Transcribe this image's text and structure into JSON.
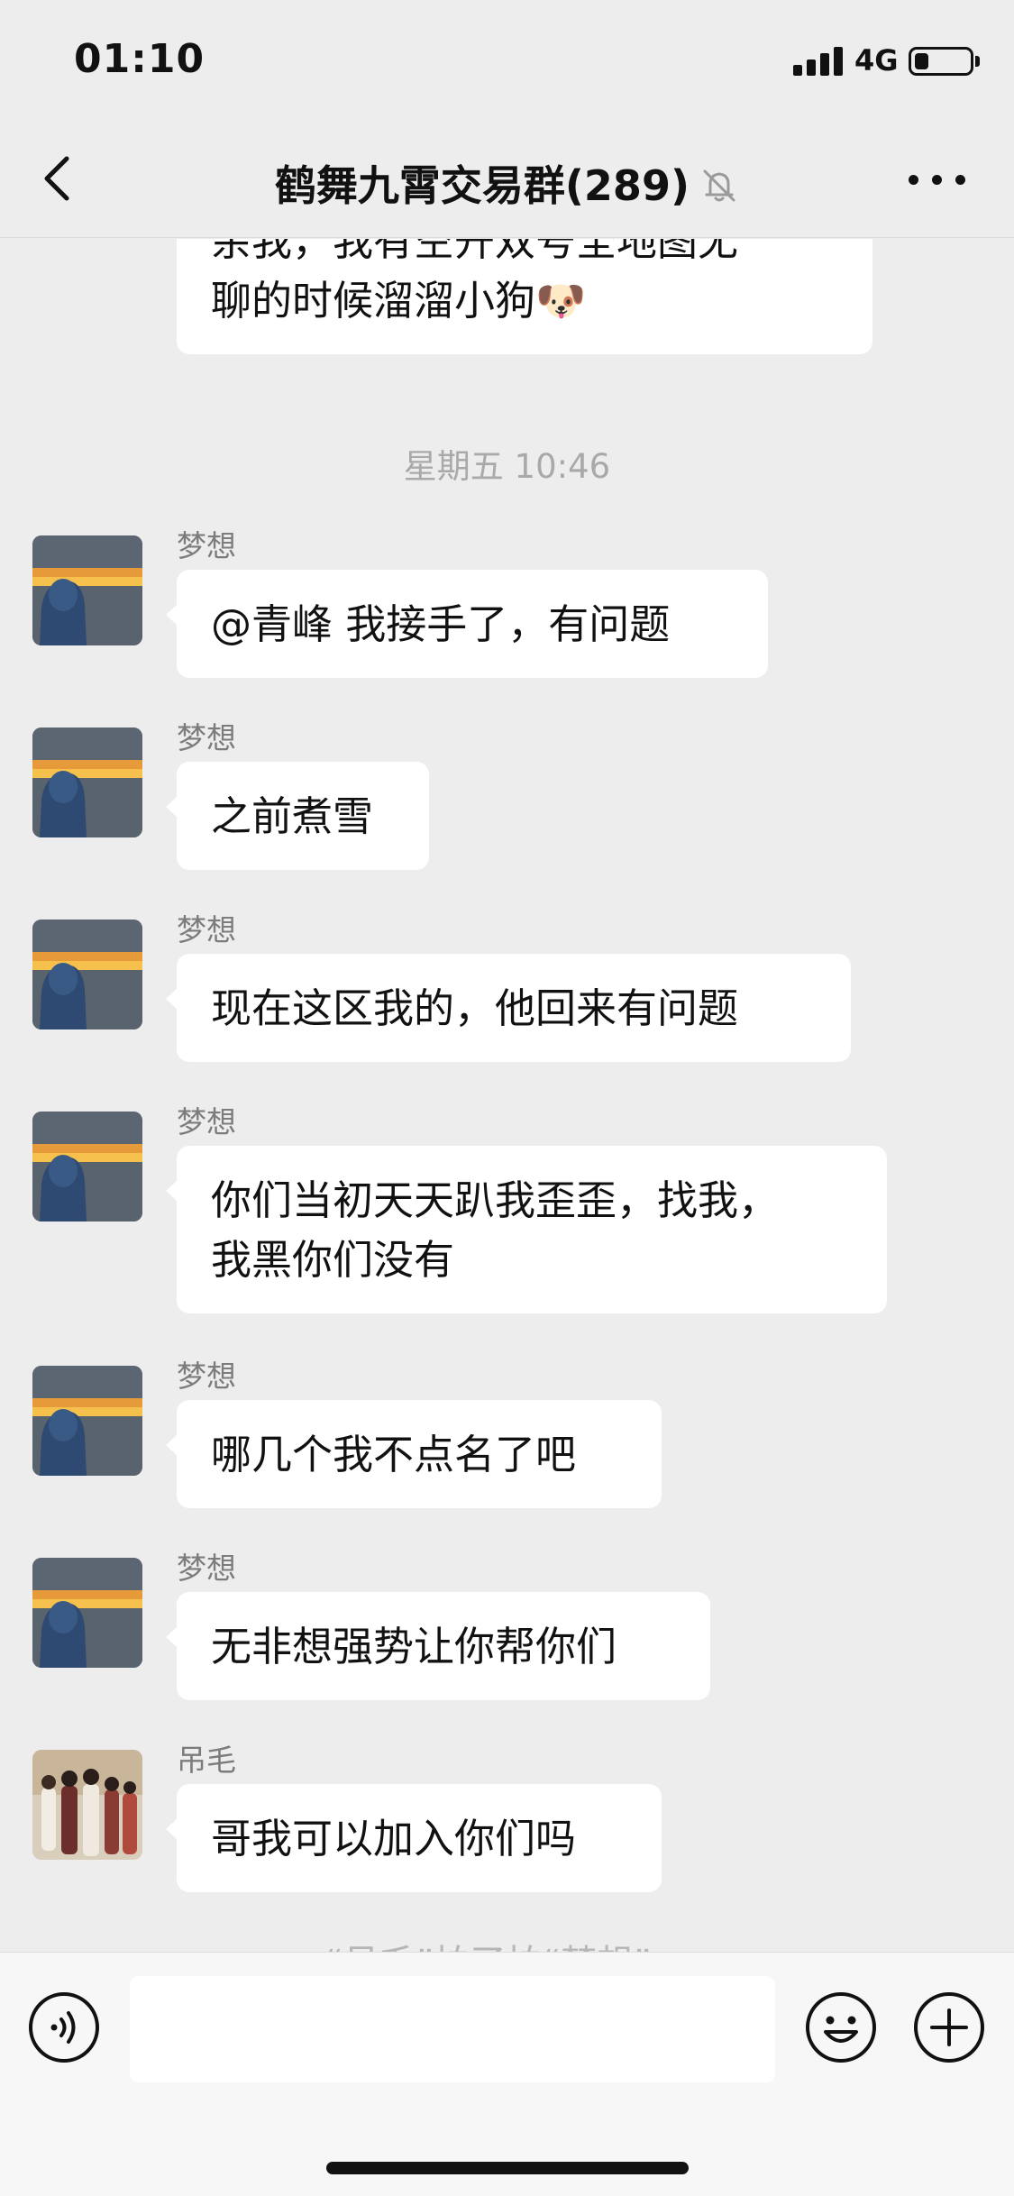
{
  "status_bar": {
    "time": "01:10",
    "network": "4G",
    "battery_level": 0.25
  },
  "nav": {
    "title": "鹤舞九霄交易群(289)",
    "back_icon": "chevron-left-icon",
    "mute_icon": "bell-slash-icon",
    "more_icon": "ellipsis-icon"
  },
  "chat": {
    "partial_message": {
      "line1": "余我，我有空开双号全地图无",
      "line2": "聊的时候溜溜小狗🐶"
    },
    "time_divider": "星期五 10:46",
    "messages": [
      {
        "sender": "梦想",
        "avatar": "sunset-silhouette-avatar",
        "lines": [
          "@青峰 我接手了，有问题"
        ]
      },
      {
        "sender": "梦想",
        "avatar": "sunset-silhouette-avatar",
        "lines": [
          "之前煮雪"
        ]
      },
      {
        "sender": "梦想",
        "avatar": "sunset-silhouette-avatar",
        "lines": [
          "现在这区我的，他回来有问题"
        ]
      },
      {
        "sender": "梦想",
        "avatar": "sunset-silhouette-avatar",
        "lines": [
          "你们当初天天趴我歪歪，找我，",
          "我黑你们没有"
        ]
      },
      {
        "sender": "梦想",
        "avatar": "sunset-silhouette-avatar",
        "lines": [
          "哪几个我不点名了吧"
        ]
      },
      {
        "sender": "梦想",
        "avatar": "sunset-silhouette-avatar",
        "lines": [
          "无非想强势让你帮你们"
        ]
      },
      {
        "sender": "吊毛",
        "avatar": "group-portrait-avatar",
        "lines": [
          "哥我可以加入你们吗"
        ]
      }
    ],
    "system_notice_partial": "“吊毛”拍了拍“梦想”"
  },
  "input_bar": {
    "voice_icon": "voice-icon",
    "input_value": "",
    "emoji_icon": "emoji-icon",
    "plus_icon": "plus-icon"
  },
  "colors": {
    "background": "#ededed",
    "bubble": "#ffffff",
    "text": "#111111",
    "meta_text": "#a9a9a9"
  }
}
